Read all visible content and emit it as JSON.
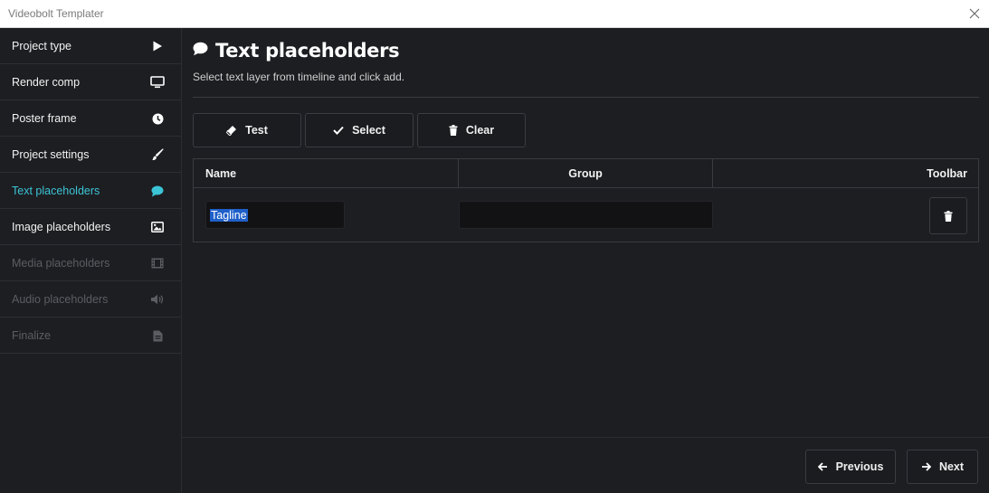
{
  "window": {
    "title": "Videobolt Templater",
    "close_icon": "close-icon"
  },
  "sidebar": {
    "items": [
      {
        "label": "Project type",
        "icon": "play-icon",
        "state": "normal"
      },
      {
        "label": "Render comp",
        "icon": "monitor-icon",
        "state": "normal"
      },
      {
        "label": "Poster frame",
        "icon": "clock-icon",
        "state": "normal"
      },
      {
        "label": "Project settings",
        "icon": "brush-icon",
        "state": "normal"
      },
      {
        "label": "Text placeholders",
        "icon": "speech-bubble-icon",
        "state": "active"
      },
      {
        "label": "Image placeholders",
        "icon": "image-icon",
        "state": "normal"
      },
      {
        "label": "Media placeholders",
        "icon": "film-icon",
        "state": "disabled"
      },
      {
        "label": "Audio placeholders",
        "icon": "volume-icon",
        "state": "disabled"
      },
      {
        "label": "Finalize",
        "icon": "document-icon",
        "state": "disabled"
      }
    ],
    "active_color": "#3bc4d6"
  },
  "main": {
    "title": "Text placeholders",
    "title_icon": "speech-bubble-icon",
    "subtitle": "Select text layer from timeline and click add."
  },
  "toolbar": {
    "test_label": "Test",
    "select_label": "Select",
    "clear_label": "Clear"
  },
  "table": {
    "columns": [
      "Name",
      "Group",
      "Toolbar"
    ],
    "rows": [
      {
        "name": "Tagline",
        "group": "",
        "delete_icon": "trash-icon"
      }
    ]
  },
  "footer": {
    "previous_label": "Previous",
    "next_label": "Next"
  }
}
